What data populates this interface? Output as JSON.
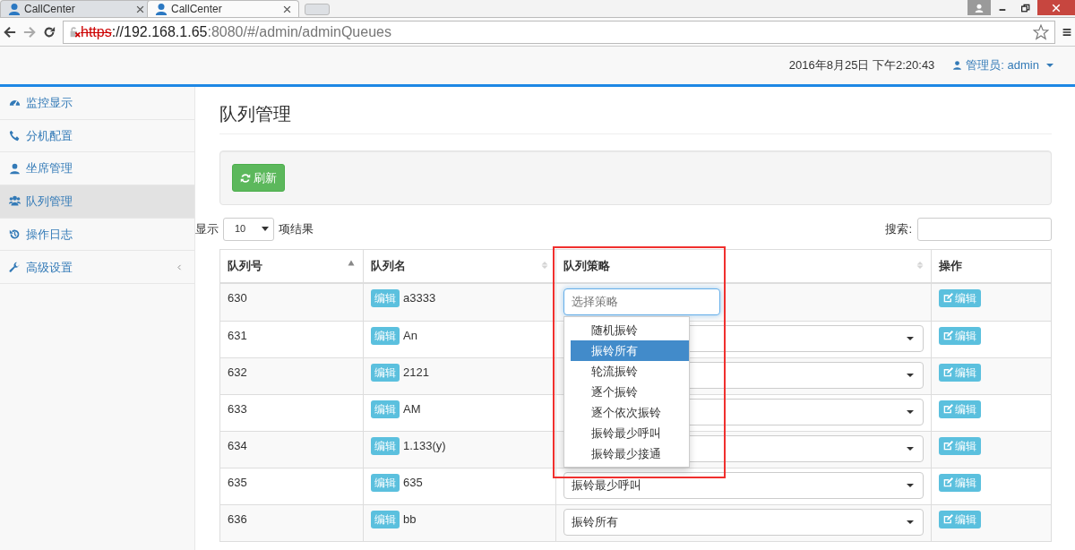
{
  "browser": {
    "tabs": [
      {
        "title": "CallCenter",
        "selected": false
      },
      {
        "title": "CallCenter",
        "selected": true
      }
    ],
    "url": [
      {
        "text": "https",
        "kind": "insecure"
      },
      {
        "text": "://192.168.1.65",
        "kind": "host"
      },
      {
        "text": ":8080/#/admin/adminQueues",
        "kind": "path"
      }
    ]
  },
  "header": {
    "datetime": "2016年8月25日 下午2:20:43",
    "user": "管理员: admin"
  },
  "sidebar": {
    "items": [
      {
        "label": "监控显示",
        "selected": false
      },
      {
        "label": "分机配置",
        "selected": false
      },
      {
        "label": "坐席管理",
        "selected": false
      },
      {
        "label": "队列管理",
        "selected": true
      },
      {
        "label": "操作日志",
        "selected": false
      },
      {
        "label": "高级设置",
        "selected": false,
        "expanded": false
      }
    ]
  },
  "page": {
    "title": "队列管理",
    "refresh": "刷新",
    "length": {
      "prefix": "显示",
      "value": "10",
      "suffix": "项结果"
    },
    "search_label": "搜索:"
  },
  "table": {
    "columns": [
      {
        "label": "队列号",
        "sortable": true,
        "sorted": true
      },
      {
        "label": "队列名",
        "sortable": true,
        "sorted": false
      },
      {
        "label": "队列策略",
        "sortable": true,
        "sorted": false
      },
      {
        "label": "操作",
        "sortable": false,
        "sorted": false
      }
    ],
    "rows": [
      {
        "id": "630",
        "name_button": "编辑",
        "name": "a3333",
        "action_button": "编辑",
        "picker": {
          "placeholder": "选择策略",
          "options": [
            {
              "label": "随机振铃",
              "selected": false
            },
            {
              "label": "振铃所有",
              "selected": true
            },
            {
              "label": "轮流振铃",
              "selected": false
            },
            {
              "label": "逐个振铃",
              "selected": false
            },
            {
              "label": "逐个依次振铃",
              "selected": false
            },
            {
              "label": "振铃最少呼叫",
              "selected": false
            },
            {
              "label": "振铃最少接通",
              "selected": false
            }
          ]
        }
      },
      {
        "id": "631",
        "name_button": "编辑",
        "name": "An",
        "action_button": "编辑"
      },
      {
        "id": "632",
        "name_button": "编辑",
        "name": "2121",
        "action_button": "编辑"
      },
      {
        "id": "633",
        "name_button": "编辑",
        "name": "AM",
        "action_button": "编辑"
      },
      {
        "id": "634",
        "name_button": "编辑",
        "name": "1.133(y)",
        "action_button": "编辑"
      },
      {
        "id": "635",
        "name_button": "编辑",
        "name": "635",
        "strategy": "振铃最少呼叫",
        "action_button": "编辑"
      },
      {
        "id": "636",
        "name_button": "编辑",
        "name": "bb",
        "strategy": "振铃所有",
        "action_button": "编辑"
      }
    ]
  }
}
